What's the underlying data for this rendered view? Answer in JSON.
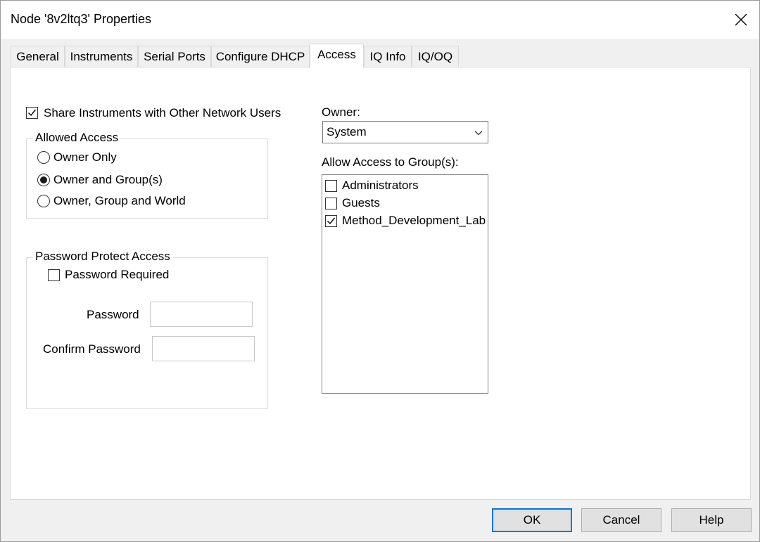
{
  "window": {
    "title": "Node '8v2ltq3' Properties"
  },
  "tabs": [
    "General",
    "Instruments",
    "Serial Ports",
    "Configure DHCP",
    "Access",
    "IQ Info",
    "IQ/OQ"
  ],
  "access": {
    "share_label": "Share Instruments with Other Network Users",
    "share_checked": true,
    "allowed_access": {
      "legend": "Allowed Access",
      "options": [
        "Owner Only",
        "Owner and Group(s)",
        "Owner, Group and World"
      ],
      "selected": "Owner and Group(s)"
    },
    "password": {
      "legend": "Password Protect Access",
      "required_label": "Password Required",
      "required_checked": false,
      "password_label": "Password",
      "password_value": "",
      "confirm_label": "Confirm Password",
      "confirm_value": ""
    },
    "owner": {
      "label": "Owner:",
      "value": "System"
    },
    "groups": {
      "label": "Allow Access to Group(s):",
      "items": [
        {
          "name": "Administrators",
          "checked": false
        },
        {
          "name": "Guests",
          "checked": false
        },
        {
          "name": "Method_Development_Lab",
          "checked": true
        }
      ]
    }
  },
  "buttons": {
    "ok": "OK",
    "cancel": "Cancel",
    "help": "Help"
  },
  "icons": {
    "close": "close-icon",
    "dropdown": "chevron-down-icon",
    "check": "checkmark-icon"
  },
  "colors": {
    "accent": "#0078d7",
    "dialog_bg": "#f0f0f0",
    "panel_bg": "#ffffff"
  }
}
